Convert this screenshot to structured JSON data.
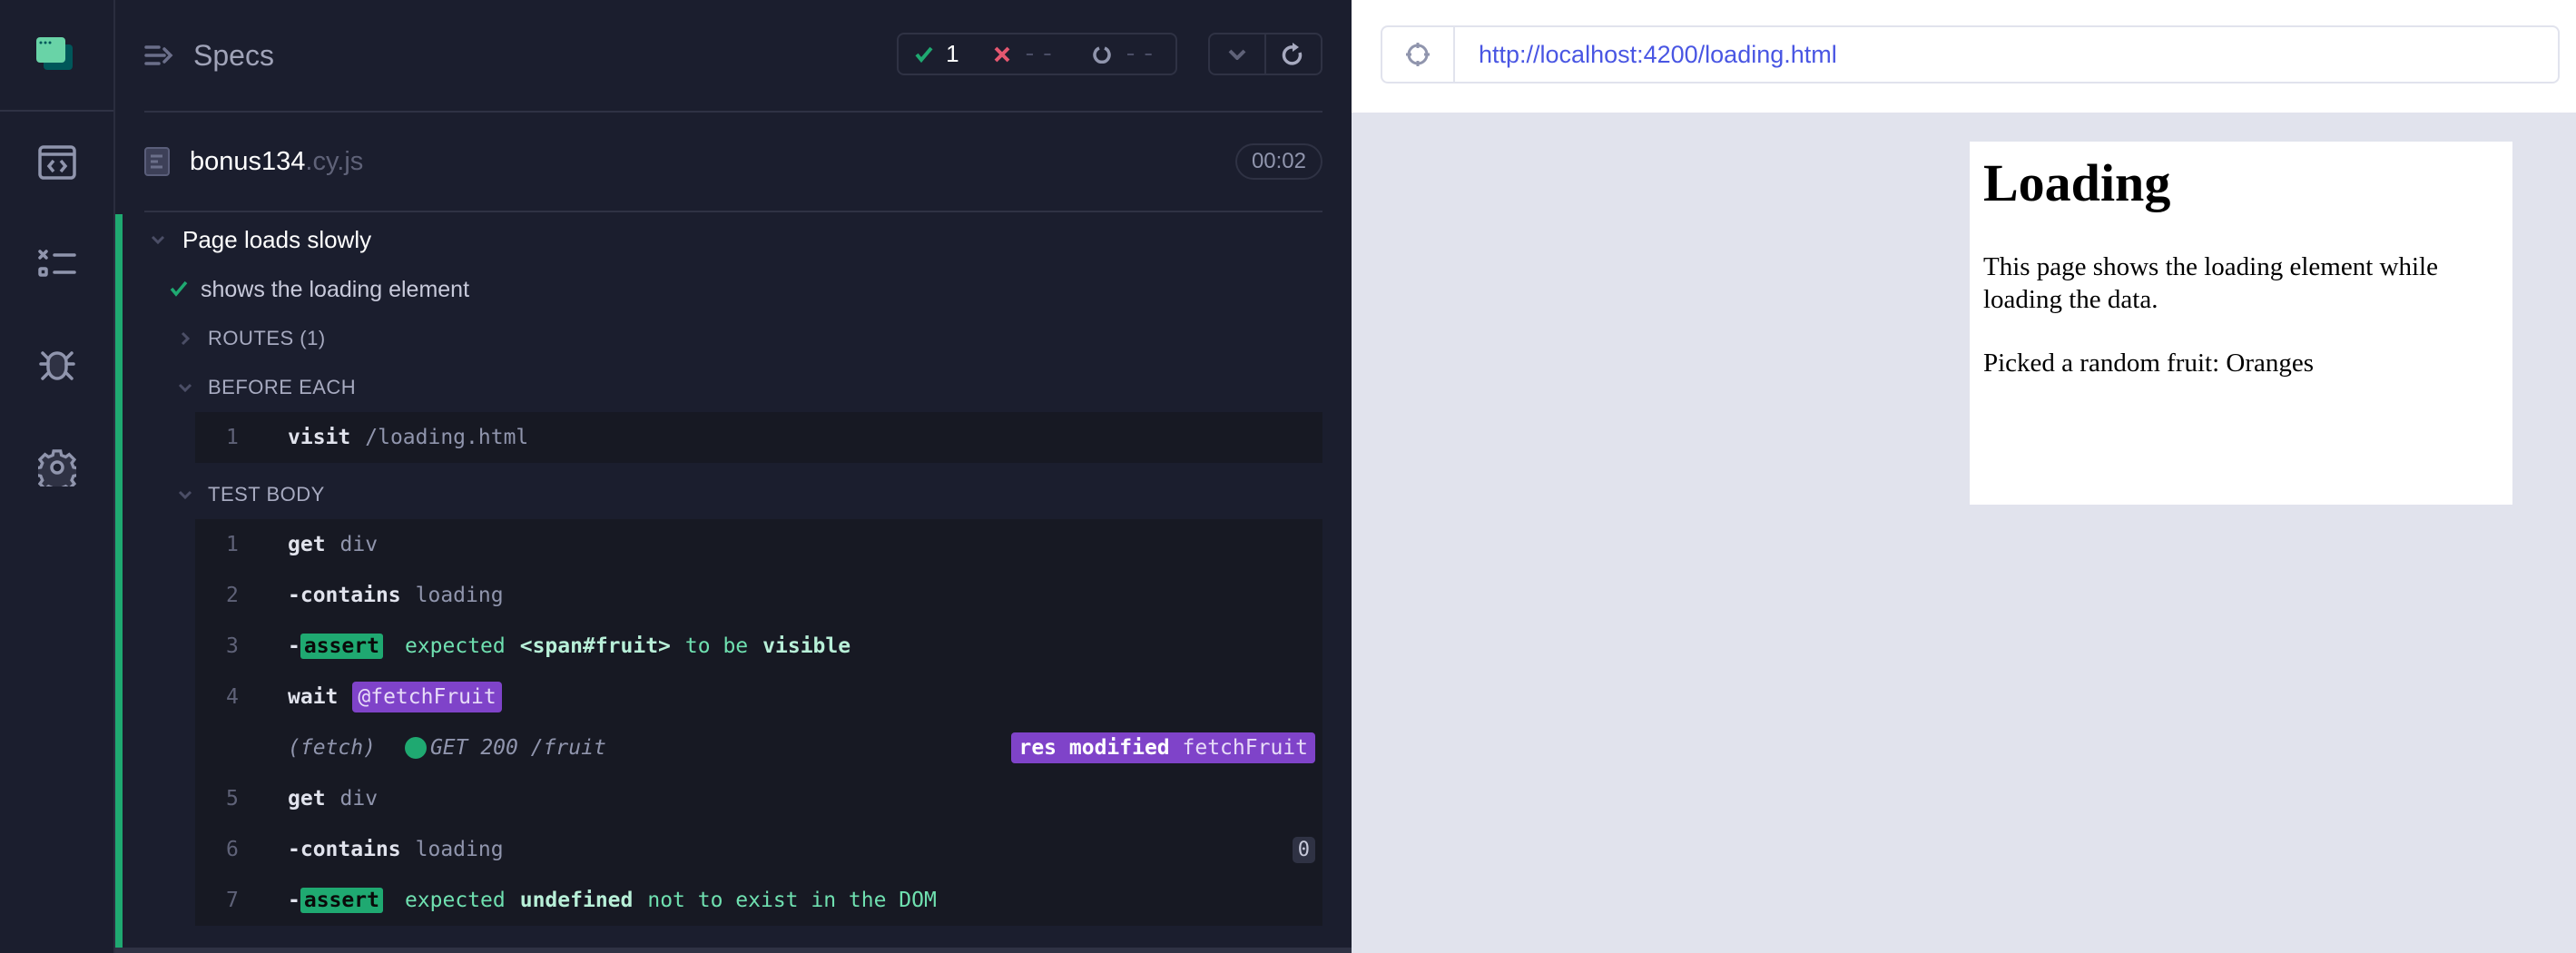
{
  "nav": {
    "items": [
      {
        "name": "specs",
        "icon": "code-window-icon"
      },
      {
        "name": "runs",
        "icon": "checklist-icon"
      },
      {
        "name": "debug",
        "icon": "bug-icon"
      },
      {
        "name": "settings",
        "icon": "gear-icon"
      }
    ]
  },
  "header": {
    "title": "Specs",
    "stats": {
      "passed": "1",
      "failed": "--",
      "pending": "--"
    }
  },
  "file": {
    "name": "bonus134",
    "ext": ".cy.js",
    "duration": "00:02"
  },
  "suite": {
    "title": "Page loads slowly",
    "test": "shows the loading element",
    "routes_label": "ROUTES (1)",
    "before_each_label": "BEFORE EACH",
    "test_body_label": "TEST BODY",
    "before_each": [
      {
        "num": "1",
        "name": "visit",
        "msg": "/loading.html"
      }
    ],
    "commands": [
      {
        "num": "1",
        "name": "get",
        "msg": "div"
      },
      {
        "num": "2",
        "dash": "-",
        "name": "contains",
        "msg": "loading"
      },
      {
        "num": "3",
        "dash": "-",
        "badge": "assert",
        "parts": [
          "expected",
          "<span#fruit>",
          "to be",
          "visible"
        ]
      },
      {
        "num": "4",
        "name": "wait",
        "alias": "@fetchFruit"
      },
      {
        "fetch": "(fetch)",
        "request": "GET 200 /fruit",
        "route_badge_bold": "res modified",
        "route_badge_alias": "fetchFruit"
      },
      {
        "num": "5",
        "name": "get",
        "msg": "div"
      },
      {
        "num": "6",
        "dash": "-",
        "name": "contains",
        "msg": "loading",
        "count": "0"
      },
      {
        "num": "7",
        "dash": "-",
        "badge": "assert",
        "parts": [
          "expected",
          "undefined",
          "not to exist in the DOM"
        ]
      }
    ]
  },
  "aut": {
    "url": "http://localhost:4200/loading.html",
    "heading": "Loading",
    "para1": "This page shows the loading element while loading the data.",
    "para2": "Picked a random fruit: Oranges"
  },
  "colors": {
    "pass": "#1fa971",
    "fail": "#e45770",
    "alias": "#7f43c9",
    "url": "#4956e3"
  }
}
